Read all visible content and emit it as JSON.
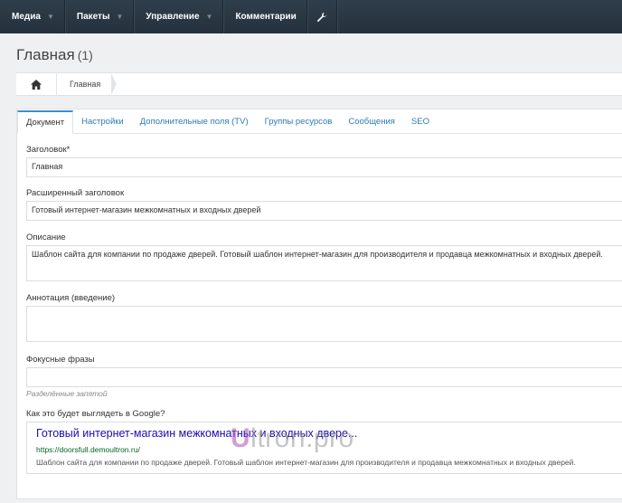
{
  "topbar": {
    "menus": [
      "Медиа",
      "Пакеты",
      "Управление",
      "Комментарии"
    ],
    "tool_icon": "wrench-icon"
  },
  "page": {
    "title": "Главная",
    "count": "(1)"
  },
  "breadcrumb": {
    "home_icon": "home-icon",
    "current": "Главная"
  },
  "tabs": [
    "Документ",
    "Настройки",
    "Дополнительные поля (TV)",
    "Группы ресурсов",
    "Сообщения",
    "SEO"
  ],
  "form": {
    "title_label": "Заголовок*",
    "title_value": "Главная",
    "longtitle_label": "Расширенный заголовок",
    "longtitle_value": "Готовый интернет-магазин межкомнатных и входных дверей",
    "description_label": "Описание",
    "description_value": "Шаблон сайта для компании по продаже дверей. Готовый шаблон интернет-магазин для производителя и продавца межкомнатных и входных дверей.",
    "introtext_label": "Аннотация (введение)",
    "introtext_value": "",
    "keywords_label": "Фокусные фразы",
    "keywords_value": "",
    "keywords_hint": "Разделённые запятой",
    "google_label": "Как это будет выглядеть в Google?"
  },
  "snippet": {
    "title": "Готовый интернет-магазин межкомнатных и входных двере...",
    "url": "https://doorsfull.demoultron.ru/",
    "description": "Шаблон сайта для компании по продаже дверей. Готовый шаблон интернет-магазин для производителя и продавца межкомнатных и входных дверей."
  },
  "watermark": {
    "mark": "U",
    "text": "ltron.pro"
  },
  "colors": {
    "topbar": "#2f3e4b",
    "link": "#2a7ab8",
    "snippet_title": "#1a0dab",
    "snippet_url": "#006621"
  }
}
